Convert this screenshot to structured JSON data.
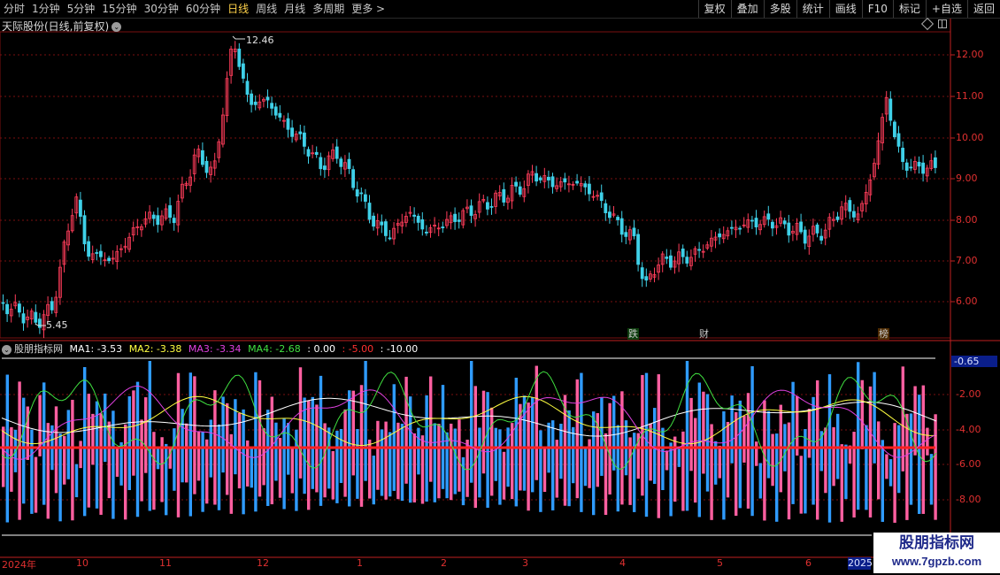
{
  "toolbar": {
    "periods": [
      "分时",
      "1分钟",
      "5分钟",
      "15分钟",
      "30分钟",
      "60分钟",
      "日线",
      "周线",
      "月线",
      "多周期",
      "更多 >"
    ],
    "active_period": "日线",
    "tools": [
      "复权",
      "叠加",
      "多股",
      "统计",
      "画线",
      "F10",
      "标记",
      "+自选",
      "返回"
    ]
  },
  "main_chart": {
    "title": "天际股份(日线,前复权)",
    "high_label": "12.46",
    "low_label": "5.45",
    "y_ticks": [
      "12.00",
      "11.00",
      "10.00",
      "9.00",
      "8.00",
      "7.00",
      "6.00"
    ]
  },
  "events": [
    {
      "text": "跌",
      "color": "#4cd84c"
    },
    {
      "text": "财",
      "color": "#5aa0ff"
    },
    {
      "text": "榜",
      "color": "#ff8c3a"
    }
  ],
  "indicator": {
    "name": "股朋指标网",
    "ma1": "MA1: -3.53",
    "ma2": "MA2: -3.38",
    "ma3": "MA3: -3.34",
    "ma4": "MA4: -2.68",
    "v1": ": 0.00",
    "v2": ": -5.00",
    "v3": ": -10.00",
    "highlight": "-0.65",
    "y_ticks": [
      "-2.00",
      "-4.00",
      "-6.00",
      "-8.00"
    ]
  },
  "date_axis": {
    "labels": [
      "2024年",
      "10",
      "11",
      "12",
      "1",
      "2",
      "3",
      "4",
      "5",
      "6"
    ],
    "current": "2025"
  },
  "watermark": {
    "line1": "股朋指标网",
    "line2": "www.7gpzb.com"
  },
  "colors": {
    "up": "#ff3d5a",
    "up_bar": "#ff5fa0",
    "down": "#3fd0e8",
    "down_bar": "#2f9bff",
    "grid": "#7a1010",
    "zero_line": "#ff2020",
    "ma1": "#ffffff",
    "ma2": "#ffff40",
    "ma3": "#e040e0",
    "ma4": "#40e040"
  }
}
